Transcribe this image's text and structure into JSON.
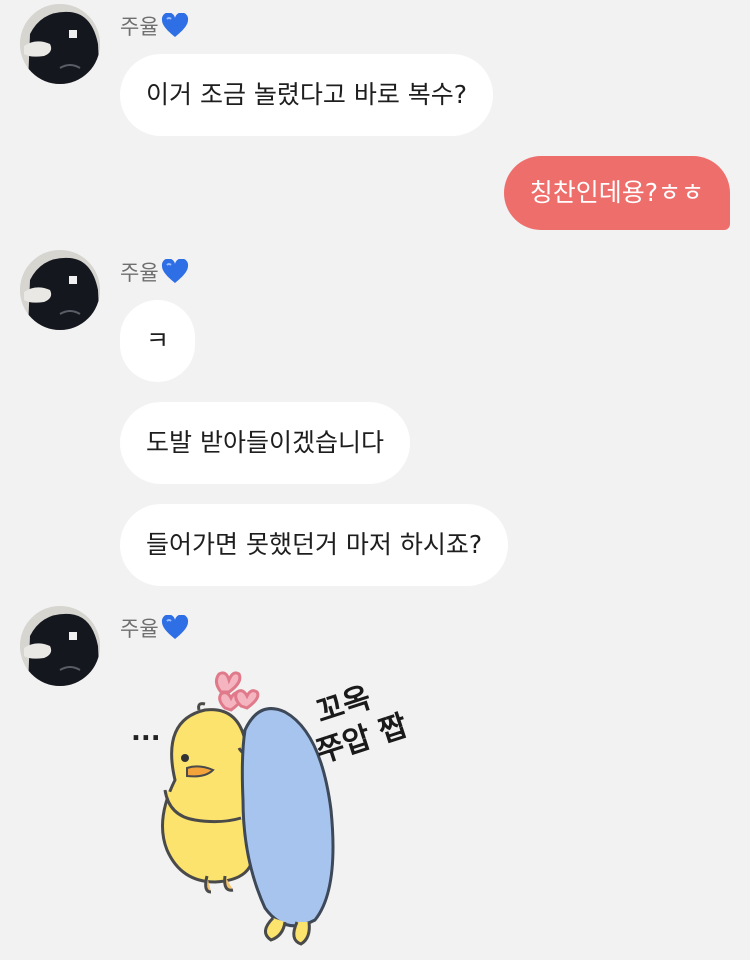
{
  "conversation": {
    "sender_name": "주율",
    "heart_icon": "blue-heart-emoji",
    "colors": {
      "background": "#f2f2f2",
      "my_bubble": "#ee6e6b",
      "their_bubble": "#ffffff"
    },
    "messages": [
      {
        "text": "이거 조금 놀렸다고 바로 복수?"
      },
      {
        "text": "칭찬인데용?ㅎㅎ"
      },
      {
        "text": "ㅋ"
      },
      {
        "text": "도발 받아들이겠습니다"
      },
      {
        "text": "들어가면 못했던거 마저 하시죠?"
      }
    ],
    "sticker": {
      "line1": "꼬옥",
      "line2": "쭈압 짭",
      "dots": "..."
    }
  }
}
